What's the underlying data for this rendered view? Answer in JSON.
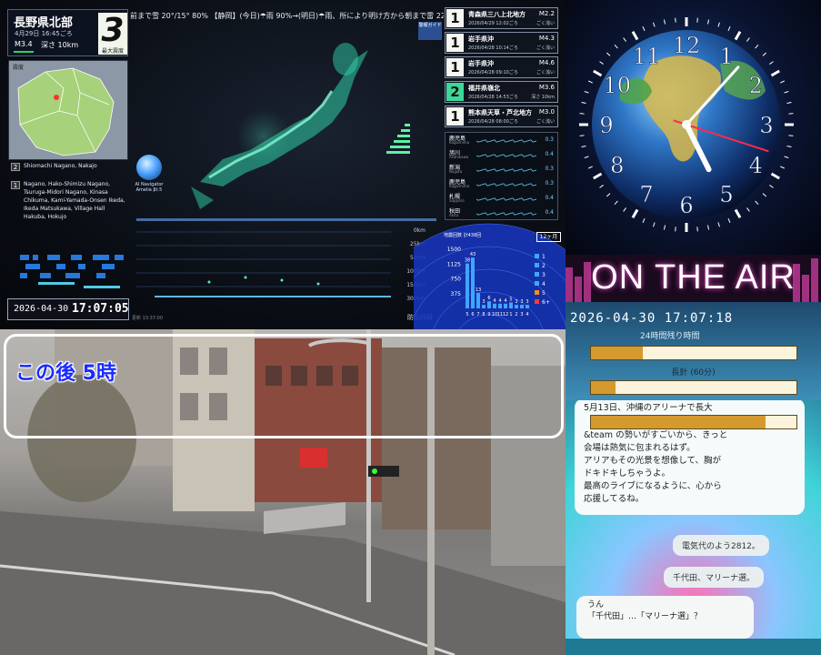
{
  "earthquake": {
    "region": "長野県北部",
    "time": "4月29日 16:45ごろ",
    "magnitude": "M3.4",
    "depth": "深さ 10km",
    "max_intensity": "3",
    "max_intensity_label": "最大震度",
    "map_label": "震度",
    "ticker": "前まで雪 20°/15° 80% 【静岡】(今日)☂雨 90%→(明日)☂雨、所により明け方から朝まで雷 22°/14° 90%",
    "stations": [
      {
        "intensity": "2",
        "names": "Shiomachi Nagano, Nakajo"
      },
      {
        "intensity": "1",
        "names": "Nagano, Hako-Shimizu Nagano, Tsuruga-Midori Nagano, Kinasa Chikuma, Kami-Yamada-Onsen Ikeda, Ikeda Matsukawa, Village Hall Hakuba, Hokujo"
      }
    ],
    "clock_date": "2026-04-30",
    "clock_time": "17:07:05",
    "ai_navigator": "AI Navigator Amelia βt.5",
    "tsunami_label": "警報ガイド",
    "depth_scale": [
      "0km",
      "25km",
      "50km",
      "100km",
      "150km",
      "300km"
    ],
    "bosai": "防災科研",
    "update_time": "更新 13:37:00"
  },
  "quake_list": [
    {
      "intensity": "1",
      "region": "青森県三八上北地方",
      "mag": "M2.2",
      "time": "2026/04/29 12:02ごろ",
      "depth": "ごく浅い",
      "green": false
    },
    {
      "intensity": "1",
      "region": "岩手県沖",
      "mag": "M4.3",
      "time": "2026/04/28 10:14ごろ",
      "depth": "ごく浅い",
      "green": false
    },
    {
      "intensity": "1",
      "region": "岩手県沖",
      "mag": "M4.6",
      "time": "2026/04/28 09:10ごろ",
      "depth": "ごく浅い",
      "green": false
    },
    {
      "intensity": "2",
      "region": "福井県嶺北",
      "mag": "M3.6",
      "time": "2026/04/28 14:53ごろ",
      "depth": "深さ 10km",
      "green": true
    },
    {
      "intensity": "1",
      "region": "熊本県天草・芦北地方",
      "mag": "M3.0",
      "time": "2026/04/28 08:00ごろ",
      "depth": "ごく浅い",
      "green": false
    }
  ],
  "seismo": [
    {
      "name": "鹿児島",
      "roman": "Kagoshima",
      "value": "0.3"
    },
    {
      "name": "旭川",
      "roman": "Asahikawa",
      "value": "0.4"
    },
    {
      "name": "新潟",
      "roman": "Niigata",
      "value": "0.3"
    },
    {
      "name": "鹿児島",
      "roman": "Kagoshima",
      "value": "0.3"
    },
    {
      "name": "札幌",
      "roman": "Sapporo",
      "value": "0.4"
    },
    {
      "name": "秋田",
      "roman": "Akita",
      "value": "0.4"
    }
  ],
  "count_panel": {
    "title": "地震回数 計438回",
    "period": "12ヶ月",
    "yticks": [
      "1500",
      "1125",
      "750",
      "375"
    ],
    "legend": [
      "1",
      "2",
      "3",
      "4",
      "5",
      "6+"
    ],
    "xlabels": [
      "5",
      "6",
      "7",
      "8",
      "9",
      "10",
      "11",
      "12",
      "1",
      "2",
      "3",
      "4"
    ]
  },
  "chart_data": {
    "type": "bar",
    "title": "地震回数 計438回",
    "categories": [
      "5",
      "6",
      "7",
      "8",
      "9",
      "10",
      "11",
      "12",
      "1",
      "2",
      "3",
      "4"
    ],
    "values": [
      38,
      43,
      13,
      3,
      6,
      4,
      4,
      4,
      5,
      3,
      3,
      3
    ],
    "ylim": [
      0,
      1500
    ]
  },
  "globe_clock": {
    "numerals": [
      "12",
      "1",
      "2",
      "3",
      "4",
      "5",
      "6",
      "7",
      "8",
      "9",
      "10",
      "11"
    ],
    "hour": 5,
    "minute": 7,
    "second": 18
  },
  "on_air": {
    "text": "ON THE AIR"
  },
  "status": {
    "datetime": "2026-04-30 17:07:18",
    "sub": "24時間残り時間",
    "bar1_fill": 0.25,
    "bar2_label": "長針 (60分)",
    "bar2_fill": 0.12,
    "bar3_fill": 0.85
  },
  "chat": {
    "main_lines": [
      "5月13日、沖縄のアリーナで長大",
      "&team の勢いがすごいから、きっと",
      "会場は熱気に包まれるはず。",
      "アリアもその光景を想像して、胸が",
      "ドキドキしちゃうよ。",
      "最高のライブになるように、心から",
      "応援してるね。"
    ],
    "reply1": "電気代のよう2812。",
    "reply2": "千代田、マリーナ選。",
    "last_lines": [
      "うん",
      "「千代田」…「マリーナ選」？"
    ]
  },
  "street": {
    "caption": "この後 5時"
  }
}
